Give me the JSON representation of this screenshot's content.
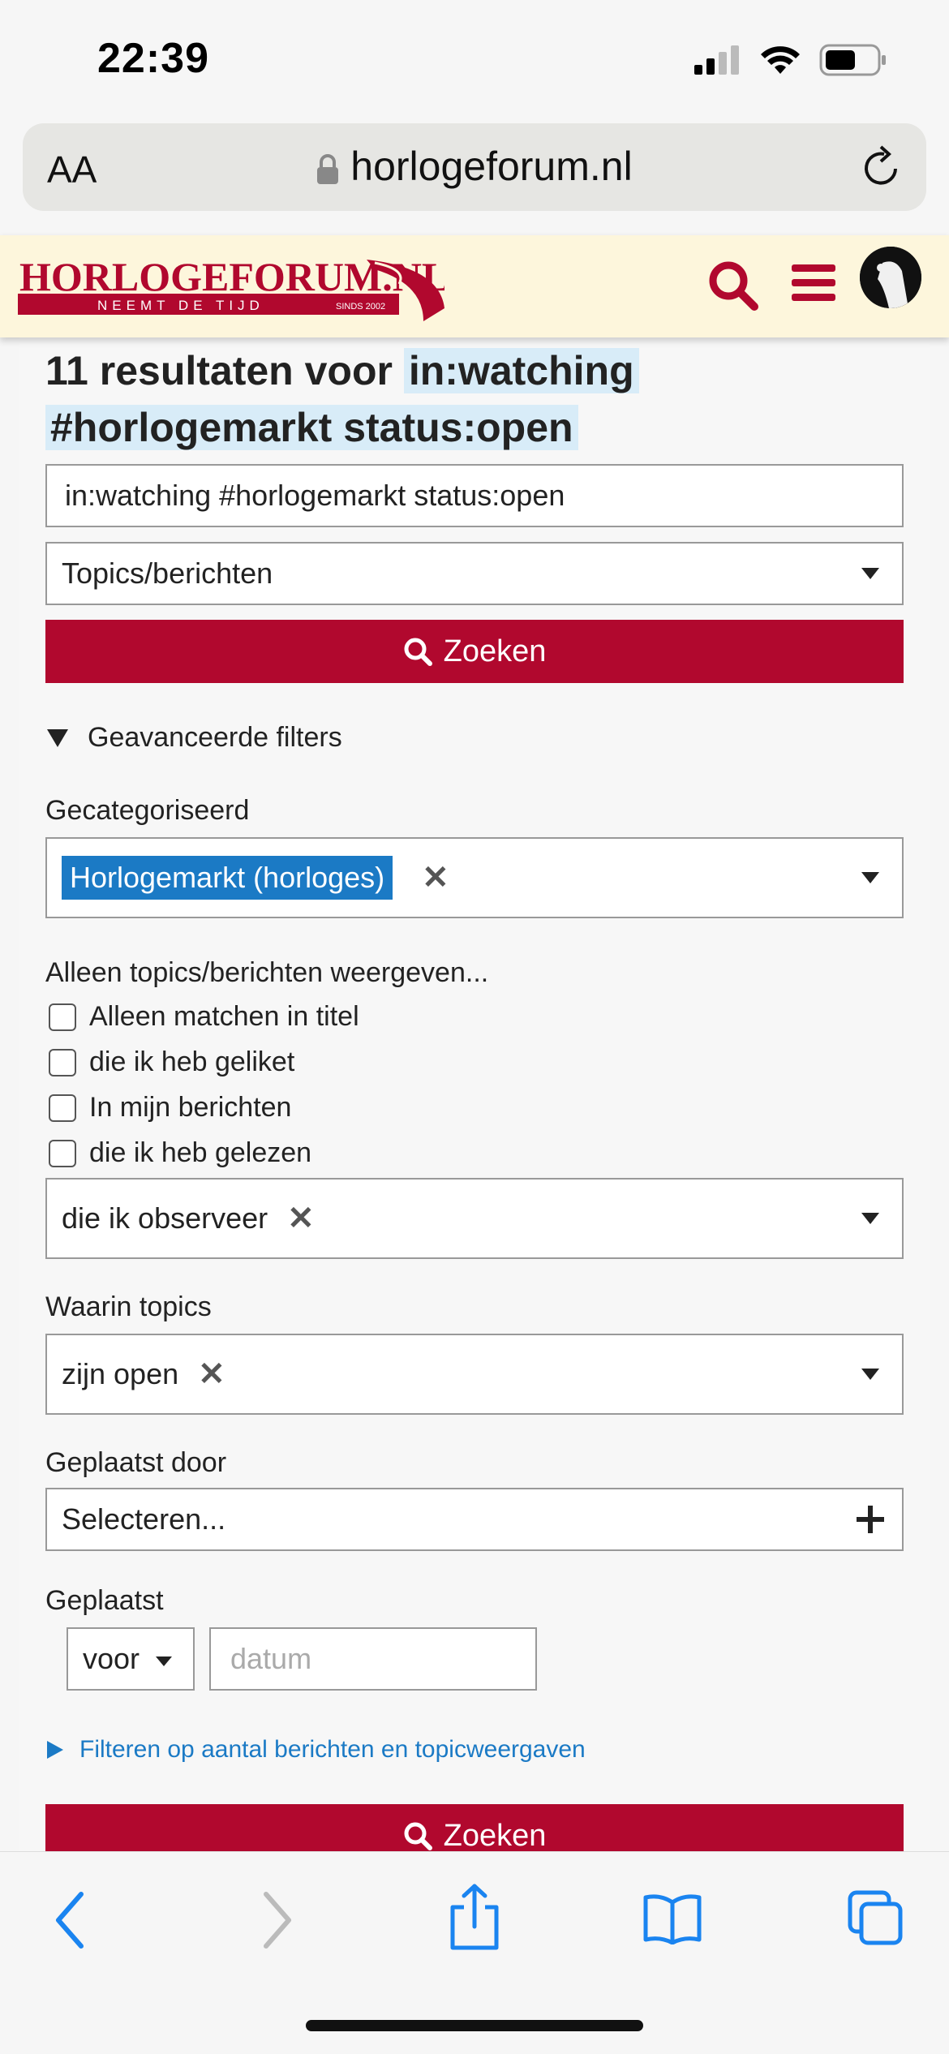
{
  "status_bar": {
    "time": "22:39"
  },
  "browser": {
    "text_size_label": "AA",
    "url": "horlogeforum.nl"
  },
  "site": {
    "logo_title": "HORLOGEFORUM.NL",
    "logo_tagline": "NEEMT DE TIJD",
    "logo_since": "SINDS 2002",
    "brand_color": "#b1082e"
  },
  "search": {
    "title_prefix": "11 resultaten voor",
    "title_query_1": "in:watching",
    "title_query_2": "#horlogemarkt status:open",
    "query_value": "in:watching #horlogemarkt status:open",
    "type_selected": "Topics/berichten",
    "search_button": "Zoeken"
  },
  "filters": {
    "advanced_label": "Geavanceerde filters",
    "categorized_label": "Gecategoriseerd",
    "category_chip": "Horlogemarkt (horloges)",
    "only_show_label": "Alleen topics/berichten weergeven...",
    "checkboxes": [
      "Alleen matchen in titel",
      "die ik heb geliket",
      "In mijn berichten",
      "die ik heb gelezen"
    ],
    "watching_chip": "die ik observeer",
    "topics_where_label": "Waarin topics",
    "topics_chip": "zijn open",
    "posted_by_label": "Geplaatst door",
    "posted_by_placeholder": "Selecteren...",
    "posted_label": "Geplaatst",
    "posted_when": "voor",
    "date_placeholder": "datum",
    "count_filter_link": "Filteren op aantal berichten en topicweergaven",
    "bottom_search_button": "Zoeken"
  }
}
